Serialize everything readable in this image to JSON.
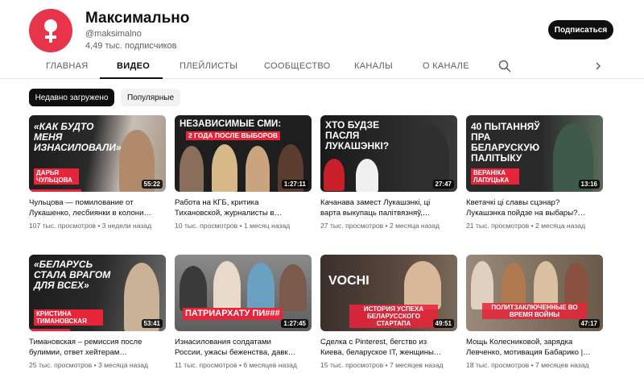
{
  "channel": {
    "name": "Максимально",
    "handle": "@maksimalno",
    "subscribers": "4,49 тыс. подписчиков",
    "avatar_color": "#e8344a",
    "subscribe_label": "Подписаться"
  },
  "tabs": [
    "ГЛАВНАЯ",
    "ВИДЕО",
    "ПЛЕЙЛИСТЫ",
    "СООБЩЕСТВО",
    "КАНАЛЫ",
    "О КАНАЛЕ"
  ],
  "active_tab": "ВИДЕО",
  "icons": {
    "search": "search-icon",
    "more": "chevron-right-icon"
  },
  "filters": {
    "recent": "Недавно загружено",
    "popular": "Популярные"
  },
  "videos": [
    {
      "thumb_text": "«КАК БУДТО МЕНЯ ИЗНАСИЛОВАЛИ»",
      "thumb_tag": "ДАРЬЯ ЧУЛЬЦОВА",
      "duration": "55:22",
      "title_line1": "Чульцова — помилование от",
      "title_line2": "Лукашенко, лесбиянки в колони…",
      "meta": "107 тыс. просмотров • 3 недели назад",
      "watched": 0.38
    },
    {
      "thumb_text": "НЕЗАВИСИМЫЕ СМИ:",
      "thumb_tag": "2 ГОДА ПОСЛЕ ВЫБОРОВ",
      "duration": "1:27:11",
      "title_line1": "Работа на КГБ, критика",
      "title_line2": "Тихановской, журналисты в…",
      "meta": "10 тыс. просмотров • 1 месяц назад",
      "watched": 0
    },
    {
      "thumb_text": "ХТО БУДЗЕ ПАСЛЯ ЛУКАШЭНКІ?",
      "thumb_tag": "",
      "duration": "27:47",
      "title_line1": "Качанава замест Лукашэнкі, ці",
      "title_line2": "варта выкупаць палітвязняў,…",
      "meta": "27 тыс. просмотров • 2 месяца назад",
      "watched": 0
    },
    {
      "thumb_text": "40 ПЫТАННЯЎ ПРА БЕЛАРУСКУЮ ПАЛІТЫКУ",
      "thumb_tag": "ВЕРАНІКА ЛАПУЦЬКА",
      "duration": "13:16",
      "title_line1": "Кветачкі ці славы сцэнар?",
      "title_line2": "Лукашэнка пойдзе на выбары?…",
      "meta": "21 тыс. просмотров • 2 месяца назад",
      "watched": 0
    },
    {
      "thumb_text": "«БЕЛАРУСЬ СТАЛА ВРАГОМ ДЛЯ ВСЕХ»",
      "thumb_tag": "КРИСТИНА ТИМАНОВСКАЯ",
      "duration": "53:41",
      "title_line1": "Тимановская – ремиссия после",
      "title_line2": "булимии, ответ хейтерам…",
      "meta": "25 тыс. просмотров • 3 месяца назад",
      "watched": 0.3
    },
    {
      "thumb_text": "",
      "thumb_tag": "ПАТРИАРХАТУ ПИ###",
      "duration": "1:27:45",
      "title_line1": "Изнасилования солдатами",
      "title_line2": "России, ужасы беженства, давк…",
      "meta": "11 тыс. просмотров • 6 месяцев назад",
      "watched": 0
    },
    {
      "thumb_text": "VOCHI",
      "thumb_tag": "ИСТОРИЯ УСПЕХА БЕЛАРУССКОГО СТАРТАПА",
      "duration": "49:51",
      "title_line1": "Сделка с Pinterest, бегство из",
      "title_line2": "Киева, беларуское IT, женщины…",
      "meta": "15 тыс. просмотров • 7 месяцев назад",
      "watched": 0
    },
    {
      "thumb_text": "",
      "thumb_tag": "ПОЛИТЗАКЛЮЧЕННЫЕ ВО ВРЕМЯ ВОЙНЫ",
      "duration": "47:17",
      "title_line1": "Мощь Колесниковой, зарядка",
      "title_line2": "Левченко, мотивация Бабарико |…",
      "meta": "18 тыс. просмотров • 7 месяцев назад",
      "watched": 0
    }
  ]
}
